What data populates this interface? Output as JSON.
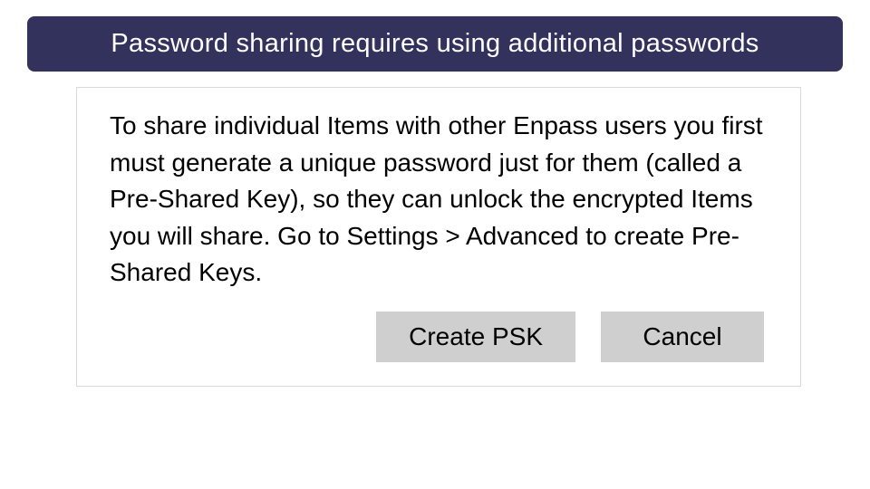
{
  "banner": {
    "title": "Password sharing requires using additional passwords"
  },
  "dialog": {
    "body": "To share individual Items with other Enpass users you first must generate a unique password just for them (called a Pre-Shared Key), so they can unlock the encrypted Items you will share. Go to Settings > Advanced to create Pre-Shared Keys.",
    "buttons": {
      "create_psk": "Create PSK",
      "cancel": "Cancel"
    }
  }
}
